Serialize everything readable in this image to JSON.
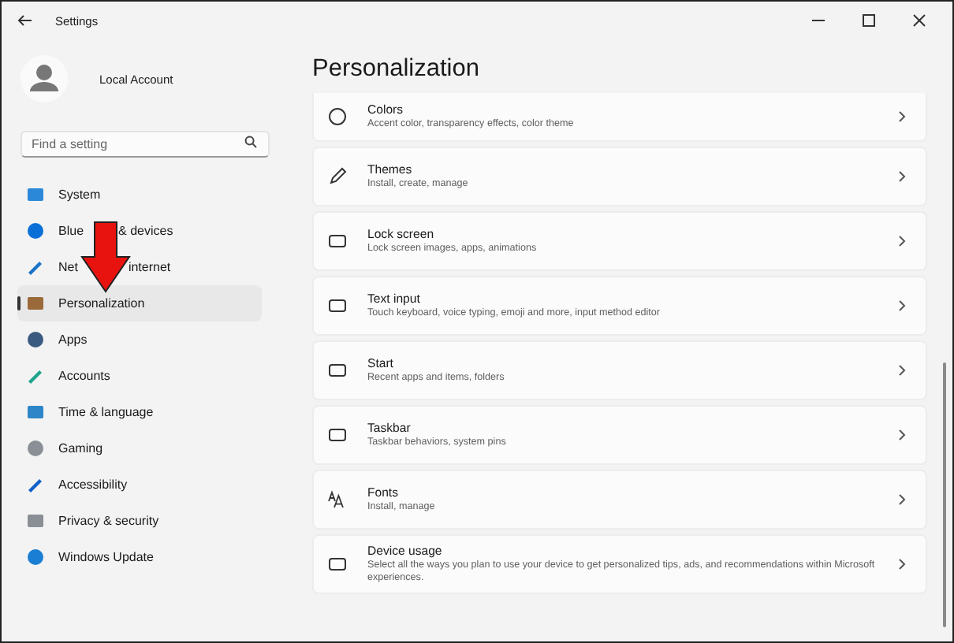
{
  "window": {
    "title": "Settings"
  },
  "account": {
    "name": "Local Account"
  },
  "search": {
    "placeholder": "Find a setting"
  },
  "sidebar": {
    "items": [
      {
        "label": "System",
        "selected": false
      },
      {
        "label_parts": [
          "Blue",
          "& devices"
        ],
        "selected": false
      },
      {
        "label_parts": [
          "Net",
          "internet"
        ],
        "selected": false
      },
      {
        "label": "Personalization",
        "selected": true
      },
      {
        "label": "Apps",
        "selected": false
      },
      {
        "label": "Accounts",
        "selected": false
      },
      {
        "label": "Time & language",
        "selected": false
      },
      {
        "label": "Gaming",
        "selected": false
      },
      {
        "label": "Accessibility",
        "selected": false
      },
      {
        "label": "Privacy & security",
        "selected": false
      },
      {
        "label": "Windows Update",
        "selected": false
      }
    ]
  },
  "page": {
    "title": "Personalization",
    "items": [
      {
        "title": "Colors",
        "description": "Accent color, transparency effects, color theme"
      },
      {
        "title": "Themes",
        "description": "Install, create, manage"
      },
      {
        "title": "Lock screen",
        "description": "Lock screen images, apps, animations"
      },
      {
        "title": "Text input",
        "description": "Touch keyboard, voice typing, emoji and more, input method editor"
      },
      {
        "title": "Start",
        "description": "Recent apps and items, folders"
      },
      {
        "title": "Taskbar",
        "description": "Taskbar behaviors, system pins"
      },
      {
        "title": "Fonts",
        "description": "Install, manage"
      },
      {
        "title": "Device usage",
        "description": "Select all the ways you plan to use your device to get personalized tips, ads, and recommendations within Microsoft experiences."
      }
    ]
  }
}
